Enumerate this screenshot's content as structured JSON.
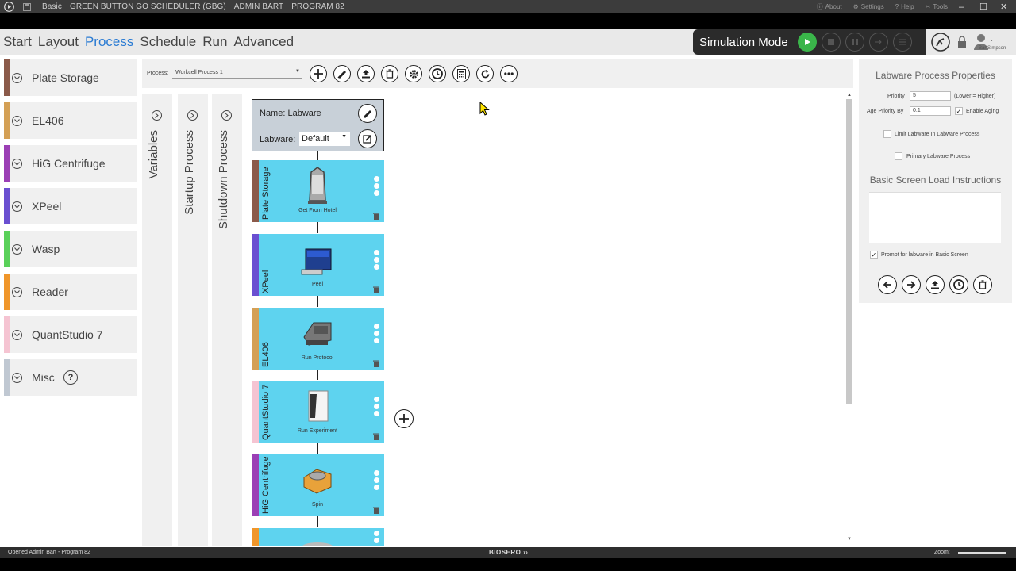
{
  "titlebar": {
    "mode": "Basic",
    "title": "GREEN BUTTON GO SCHEDULER (GBG)",
    "user": "ADMIN BART",
    "program": "PROGRAM 82",
    "about": "About",
    "settings": "Settings",
    "help": "Help",
    "tools": "Tools"
  },
  "menu": {
    "items": [
      "Start",
      "Layout",
      "Process",
      "Schedule",
      "Run",
      "Advanced"
    ],
    "active": "Process",
    "simulation_label": "Simulation Mode",
    "user_name": "BartSimpson"
  },
  "sidebar": {
    "items": [
      {
        "label": "Plate Storage",
        "color": "#8b5a4a"
      },
      {
        "label": "EL406",
        "color": "#d4a055"
      },
      {
        "label": "HiG Centrifuge",
        "color": "#9b3fb5"
      },
      {
        "label": "XPeel",
        "color": "#6a4fd1"
      },
      {
        "label": "Wasp",
        "color": "#5ad15a"
      },
      {
        "label": "Reader",
        "color": "#f0962a"
      },
      {
        "label": "QuantStudio 7",
        "color": "#f5c4d2"
      },
      {
        "label": "Misc",
        "color": "#c0c8d2"
      }
    ]
  },
  "toolbar": {
    "process_label": "Process:",
    "process_value": "Workcell Process 1"
  },
  "tabs": {
    "variables": "Variables",
    "startup": "Startup Process",
    "shutdown": "Shutdown Process"
  },
  "labware": {
    "name_label": "Name:",
    "name_value": "Labware",
    "labware_label": "Labware:",
    "labware_value": "Default"
  },
  "steps": [
    {
      "device": "Plate Storage",
      "caption": "Get From Hotel",
      "color": "#8b5a4a"
    },
    {
      "device": "XPeel",
      "caption": "Peel",
      "color": "#6a4fd1"
    },
    {
      "device": "EL406",
      "caption": "Run Protocol",
      "color": "#d4a055"
    },
    {
      "device": "QuantStudio 7",
      "caption": "Run Experiment",
      "color": "#f5c4d2"
    },
    {
      "device": "HiG Centrifuge",
      "caption": "Spin",
      "color": "#9b3fb5"
    }
  ],
  "properties": {
    "title": "Labware Process Properties",
    "priority_label": "Priority",
    "priority_value": "5",
    "priority_hint": "(Lower = Higher)",
    "age_label": "Age Priority By",
    "age_value": "0.1",
    "enable_aging": "Enable Aging",
    "limit_labware": "Limit Labware In Labware Process",
    "primary_labware": "Primary Labware Process",
    "load_title": "Basic Screen Load Instructions",
    "prompt": "Prompt for labware in Basic Screen"
  },
  "status": {
    "left": "Opened Admin Bart - Program 82",
    "brand": "BIOSERO",
    "zoom": "Zoom:"
  }
}
